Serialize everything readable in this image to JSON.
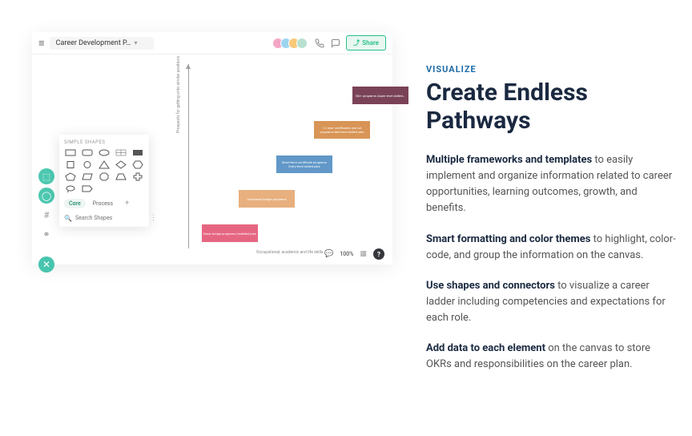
{
  "app": {
    "title": "Career Development P…",
    "share_label": "Share",
    "zoom": "100%",
    "shapes_header": "SIMPLE SHAPES",
    "search_placeholder": "Search Shapes",
    "chips": {
      "core": "Core",
      "process": "Process",
      "plus": "+"
    },
    "ylabel": "Prospects for getting onto similar positions",
    "xlabel": "Occupational, academic and life skills",
    "boxes": {
      "b1": "BA+ programs Upper level skilled…",
      "b2": "1-2 year certificates and AA programs Mid-level skilled jobs",
      "b3": "Short-term certificate programs Entry-level skilled jobs",
      "b4": "Vocational bridge programs",
      "b5": "Basic bridge programs Unskilled jobs"
    }
  },
  "right": {
    "eyebrow": "VISUALIZE",
    "headline": "Create Endless Pathways",
    "p1b": "Multiple frameworks and templates",
    "p1": " to easily implement and organize information related to career opportunities, learning outcomes, growth, and benefits.",
    "p2b": "Smart formatting and color themes",
    "p2": " to highlight, color-code, and group the information on the canvas.",
    "p3b": "Use shapes and connectors",
    "p3": " to visualize a career ladder including competencies and expectations for each role.",
    "p4b": "Add data to each element",
    "p4": " on the canvas to store OKRs and responsibilities on the career plan."
  }
}
